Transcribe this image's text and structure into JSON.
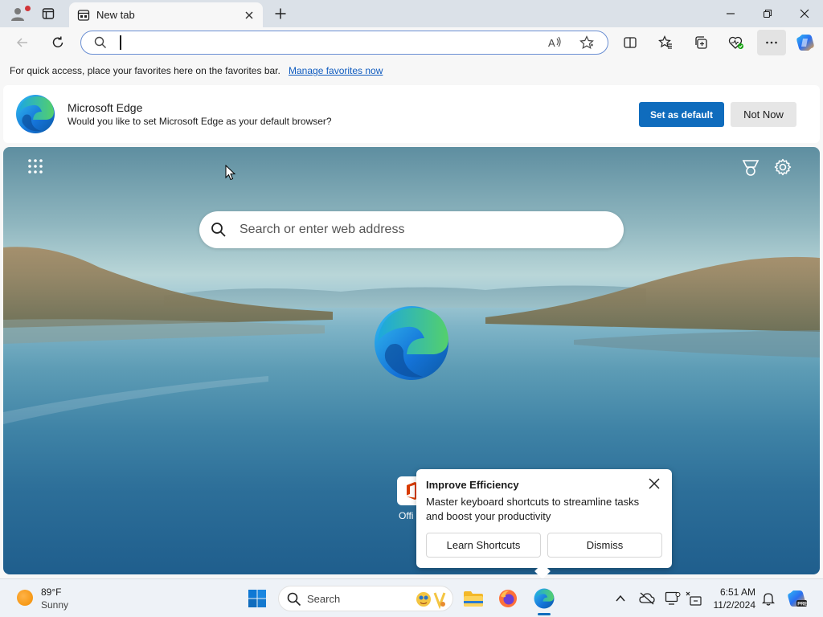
{
  "tab": {
    "title": "New tab"
  },
  "address_bar": {
    "value": "",
    "placeholder": ""
  },
  "favorites_bar": {
    "message": "For quick access, place your favorites here on the favorites bar.",
    "link": "Manage favorites now"
  },
  "banner": {
    "title": "Microsoft Edge",
    "subtitle": "Would you like to set Microsoft Edge as your default browser?",
    "primary_button": "Set as default",
    "secondary_button": "Not Now"
  },
  "new_tab": {
    "search_placeholder": "Search or enter web address",
    "quick_link_label": "Offi"
  },
  "popup": {
    "title": "Improve Efficiency",
    "body": "Master keyboard shortcuts to streamline tasks and boost your productivity",
    "learn_button": "Learn Shortcuts",
    "dismiss_button": "Dismiss"
  },
  "taskbar": {
    "weather_temp": "89°F",
    "weather_condition": "Sunny",
    "search_label": "Search",
    "time": "6:51 AM",
    "date": "11/2/2024"
  },
  "colors": {
    "accent": "#0f6cbd",
    "link": "#0f5bbf",
    "titlebar": "#dbe1e8"
  },
  "icons": {
    "toolbar": [
      "back-icon",
      "refresh-icon",
      "split-screen-icon",
      "favorites-icon",
      "collections-icon",
      "browser-essentials-icon",
      "more-icon",
      "copilot-icon"
    ],
    "tray": [
      "chevron-up-icon",
      "onedrive-icon",
      "display-icon",
      "network-icon",
      "bell-icon"
    ]
  }
}
